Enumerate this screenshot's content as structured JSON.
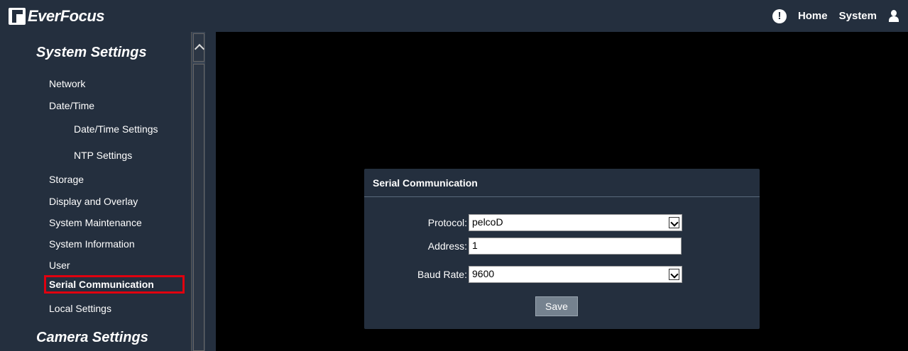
{
  "header": {
    "logo_text": "EverFocus",
    "home_label": "Home",
    "system_label": "System"
  },
  "sidebar": {
    "system_settings_title": "System Settings",
    "items": [
      {
        "label": "Network"
      },
      {
        "label": "Date/Time"
      },
      {
        "label": "Date/Time Settings"
      },
      {
        "label": "NTP Settings"
      },
      {
        "label": "Storage"
      },
      {
        "label": "Display and Overlay"
      },
      {
        "label": "System Maintenance"
      },
      {
        "label": "System Information"
      },
      {
        "label": "User"
      },
      {
        "label": "Serial Communication"
      },
      {
        "label": "Local Settings"
      }
    ],
    "camera_settings_title": "Camera Settings"
  },
  "panel": {
    "title": "Serial Communication",
    "protocol_label": "Protocol:",
    "protocol_value": "pelcoD",
    "address_label": "Address:",
    "address_value": "1",
    "baud_label": "Baud Rate:",
    "baud_value": "9600",
    "save_label": "Save"
  },
  "colors": {
    "background": "#242f3e",
    "content_bg": "#000000",
    "highlight": "#e0000f"
  }
}
